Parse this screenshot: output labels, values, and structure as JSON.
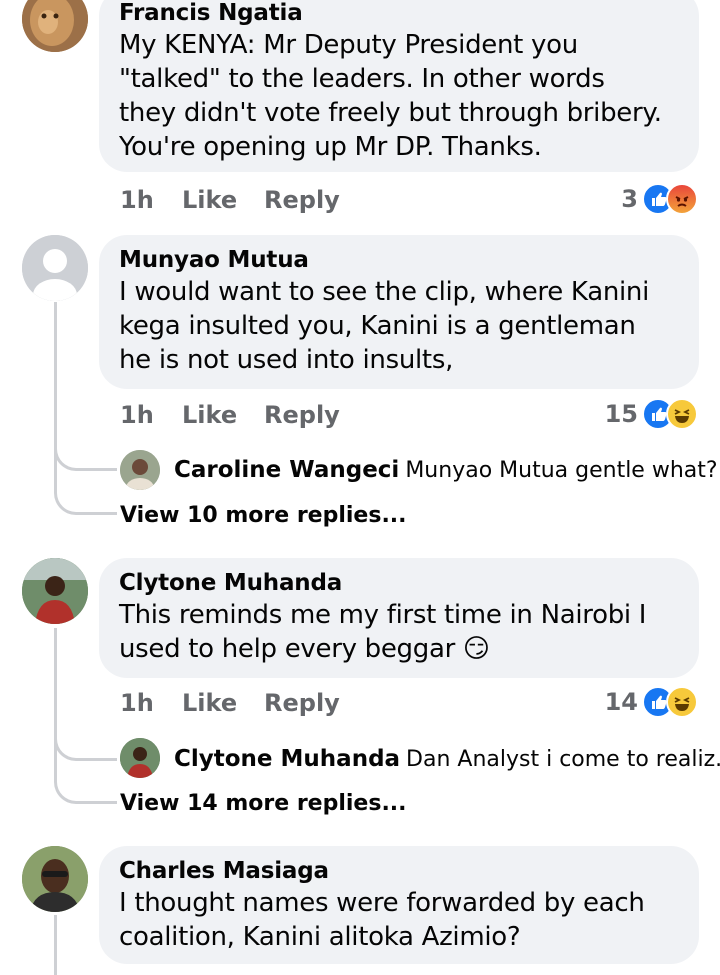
{
  "comments": [
    {
      "author": "Francis Ngatia",
      "lines": [
        "My KENYA: Mr Deputy President you",
        "\"talked\" to the leaders. In other words",
        "they didn't vote freely but through bribery.",
        "You're opening up Mr DP. Thanks."
      ],
      "time": "1h",
      "like": "Like",
      "reply": "Reply",
      "reaction_count": "3",
      "reactions": [
        "like",
        "angry"
      ]
    },
    {
      "author": "Munyao Mutua",
      "lines": [
        "I would want to see the clip, where Kanini",
        "kega insulted you, Kanini is a gentleman",
        "he is not used into insults,"
      ],
      "time": "1h",
      "like": "Like",
      "reply": "Reply",
      "reaction_count": "15",
      "reactions": [
        "like",
        "haha"
      ],
      "reply_preview": {
        "author": "Caroline Wangeci",
        "text": "Munyao Mutua gentle what?"
      },
      "more_replies": "View 10 more replies..."
    },
    {
      "author": "Clytone Muhanda",
      "lines": [
        "This reminds me my first time in Nairobi I",
        "used to help every beggar 😏"
      ],
      "time": "1h",
      "like": "Like",
      "reply": "Reply",
      "reaction_count": "14",
      "reactions": [
        "like",
        "haha"
      ],
      "reply_preview": {
        "author": "Clytone Muhanda",
        "text": "Dan Analyst i come to realiz..."
      },
      "more_replies": "View 14 more replies..."
    },
    {
      "author": "Charles Masiaga",
      "lines": [
        "I thought names were forwarded by each",
        "coalition, Kanini alitoka Azimio?"
      ]
    }
  ]
}
